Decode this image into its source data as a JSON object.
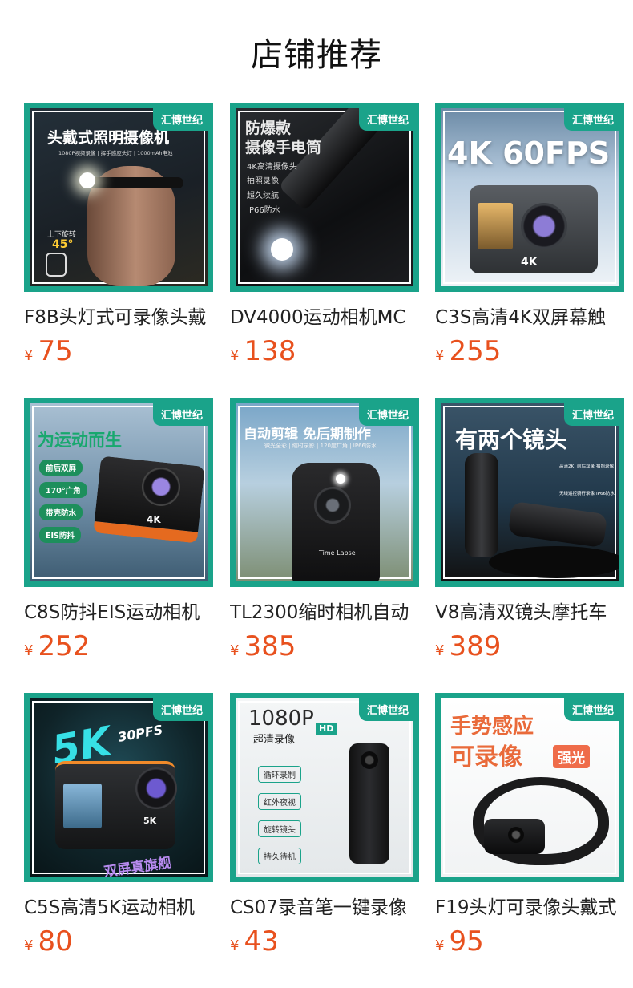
{
  "page": {
    "title": "店铺推荐",
    "accent": "#1aa38a",
    "price_color": "#e8511e"
  },
  "currency": "¥",
  "products": [
    {
      "name": "F8B头灯式可录像头戴",
      "price": "75",
      "badge": "汇博世纪",
      "image": {
        "headline": "头戴式照明摄像机",
        "subline": "1080P视频录像 | 挥手感应头灯 | 1000mAh电池",
        "angle_label": "上下旋转",
        "angle": "45°"
      }
    },
    {
      "name": "DV4000运动相机MC",
      "price": "138",
      "badge": "汇博世纪",
      "image": {
        "headline1": "防爆款",
        "headline2": "摄像手电筒",
        "features": [
          "4K高清摄像头",
          "拍照录像",
          "超久续航",
          "IP66防水"
        ]
      }
    },
    {
      "name": "C3S高清4K双屏幕触",
      "price": "255",
      "badge": "汇博世纪",
      "image": {
        "headline": "4K 60FPS",
        "device_label": "4K"
      }
    },
    {
      "name": "C8S防抖EIS运动相机",
      "price": "252",
      "badge": "汇博世纪",
      "image": {
        "headline": "为运动而生",
        "tags": [
          "前后双屏",
          "170°广角",
          "带壳防水",
          "EIS防抖"
        ],
        "device_label": "4K"
      }
    },
    {
      "name": "TL2300缩时相机自动",
      "price": "385",
      "badge": "汇博世纪",
      "image": {
        "headline": "自动剪辑 免后期制作",
        "subline": "微光全彩 | 缩时录影 | 120度广角 | IP66防水",
        "device_label": "Time Lapse"
      }
    },
    {
      "name": "V8高清双镜头摩托车",
      "price": "389",
      "badge": "汇博世纪",
      "image": {
        "headline": "有两个镜头",
        "icons": [
          "高清2K",
          "前后双录",
          "拍照录像",
          "无线遥控",
          "骑行录像",
          "IP66防水"
        ]
      }
    },
    {
      "name": "C5S高清5K运动相机",
      "price": "80",
      "badge": "汇博世纪",
      "image": {
        "headline": "5K",
        "fps": "30PFS",
        "subline": "双屏真旗舰",
        "device_label": "5K"
      }
    },
    {
      "name": "CS07录音笔一键录像",
      "price": "43",
      "badge": "汇博世纪",
      "image": {
        "headline": "1080P",
        "hd": "HD",
        "subline": "超清录像",
        "features": [
          "循环录制",
          "红外夜视",
          "旋转镜头",
          "持久待机"
        ]
      }
    },
    {
      "name": "F19头灯可录像头戴式",
      "price": "95",
      "badge": "汇博世纪",
      "image": {
        "headline1": "手势感应",
        "headline2": "可录像",
        "tag": "强光"
      }
    }
  ]
}
